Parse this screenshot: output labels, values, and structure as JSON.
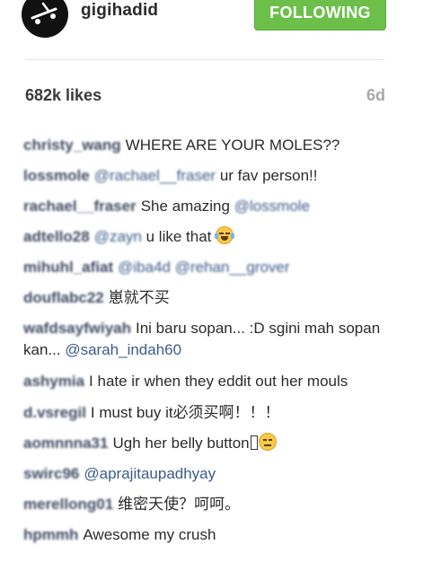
{
  "header": {
    "username": "gigihadid",
    "follow_label": "FOLLOWING"
  },
  "post": {
    "likes": "682k likes",
    "age": "6d"
  },
  "comments": [
    {
      "user": "christy_wang",
      "text": "WHERE ARE YOUR MOLES??"
    },
    {
      "user": "lossmole",
      "mention": "@rachael__fraser",
      "text": "ur fav person!!"
    },
    {
      "user": "rachael__fraser",
      "text": "She amazing",
      "mention": "@lossmole"
    },
    {
      "user": "adtello28",
      "mention": "@zayn",
      "text": "u like that"
    },
    {
      "user": "mihuhl_afiat",
      "mention": "@iba4d",
      "mention2": "@rehan__grover"
    },
    {
      "user": "douflabc22",
      "text": "崽就不买"
    },
    {
      "user": "wafdsayfwiyah",
      "text": "Ini baru sopan... :D sgini mah sopan kan...",
      "mention": "@sarah_indah60"
    },
    {
      "user": "ashymia",
      "text": "I hate ir when they eddit out her mouls"
    },
    {
      "user": "d.vsregil",
      "text": "I must buy it必须买啊！！！"
    },
    {
      "user": "aomnnna31",
      "text": "Ugh her belly button"
    },
    {
      "user": "swirc96",
      "mention": "@aprajitaupadhyay"
    },
    {
      "user": "merellong01",
      "text": "维密天使？呵呵。"
    },
    {
      "user": "hpmmh",
      "text": "Awesome my crush"
    }
  ],
  "colors": {
    "follow_green": "#6cc04a",
    "mention_blue": "#3b5c8a"
  },
  "icons": {
    "avatar": "skateboard-avatar",
    "emoji_1": "face-with-tears-of-joy",
    "emoji_2": "neutral-face"
  }
}
